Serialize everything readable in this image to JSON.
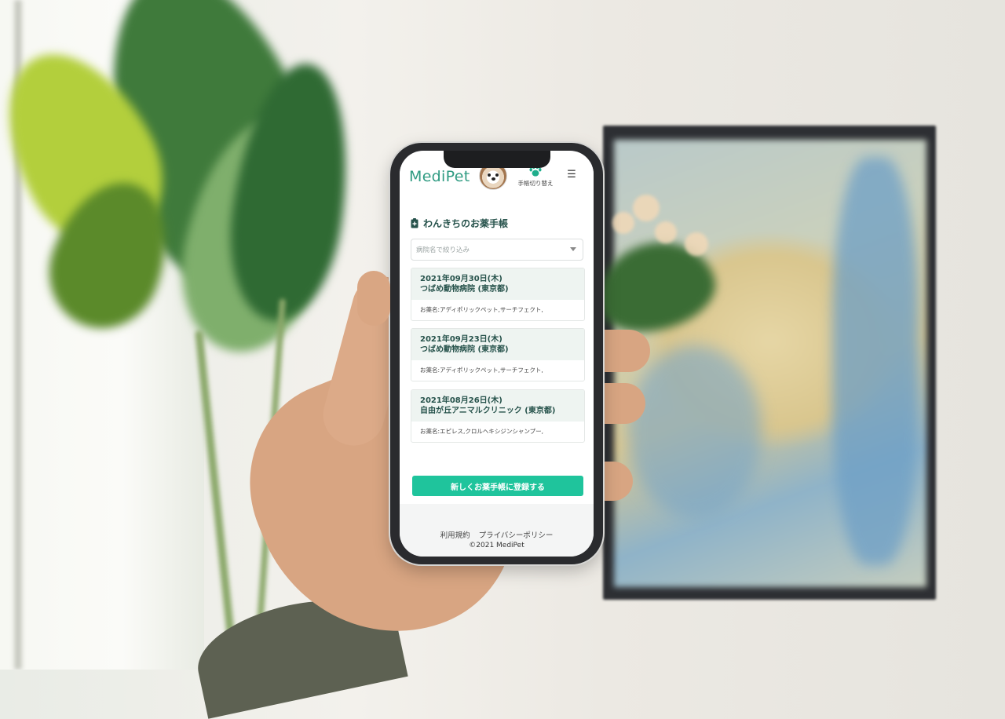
{
  "app": {
    "logo": "MediPet",
    "switch_label": "手帳切り替え",
    "menu_icon": "☰"
  },
  "page": {
    "title": "わんきちのお薬手帳",
    "filter_placeholder": "病院名で絞り込み"
  },
  "records": [
    {
      "date": "2021年09月30日(木)",
      "clinic": "つばめ動物病院 (東京都)",
      "meds": "お薬名:アディポリックペット,サーチフェクト,"
    },
    {
      "date": "2021年09月23日(木)",
      "clinic": "つばめ動物病院 (東京都)",
      "meds": "お薬名:アディポリックペット,サーチフェクト,"
    },
    {
      "date": "2021年08月26日(木)",
      "clinic": "自由が丘アニマルクリニック (東京都)",
      "meds": "お薬名:エピレス,クロルヘキシジンシャンプー,"
    }
  ],
  "actions": {
    "register": "新しくお薬手帳に登録する"
  },
  "footer": {
    "terms": "利用規約",
    "privacy": "プライバシーポリシー",
    "copyright": "©2021 MediPet"
  },
  "colors": {
    "accent": "#1fc49c",
    "logo": "#2f9b82",
    "heading": "#26524b",
    "card_header": "#eef4f1"
  }
}
